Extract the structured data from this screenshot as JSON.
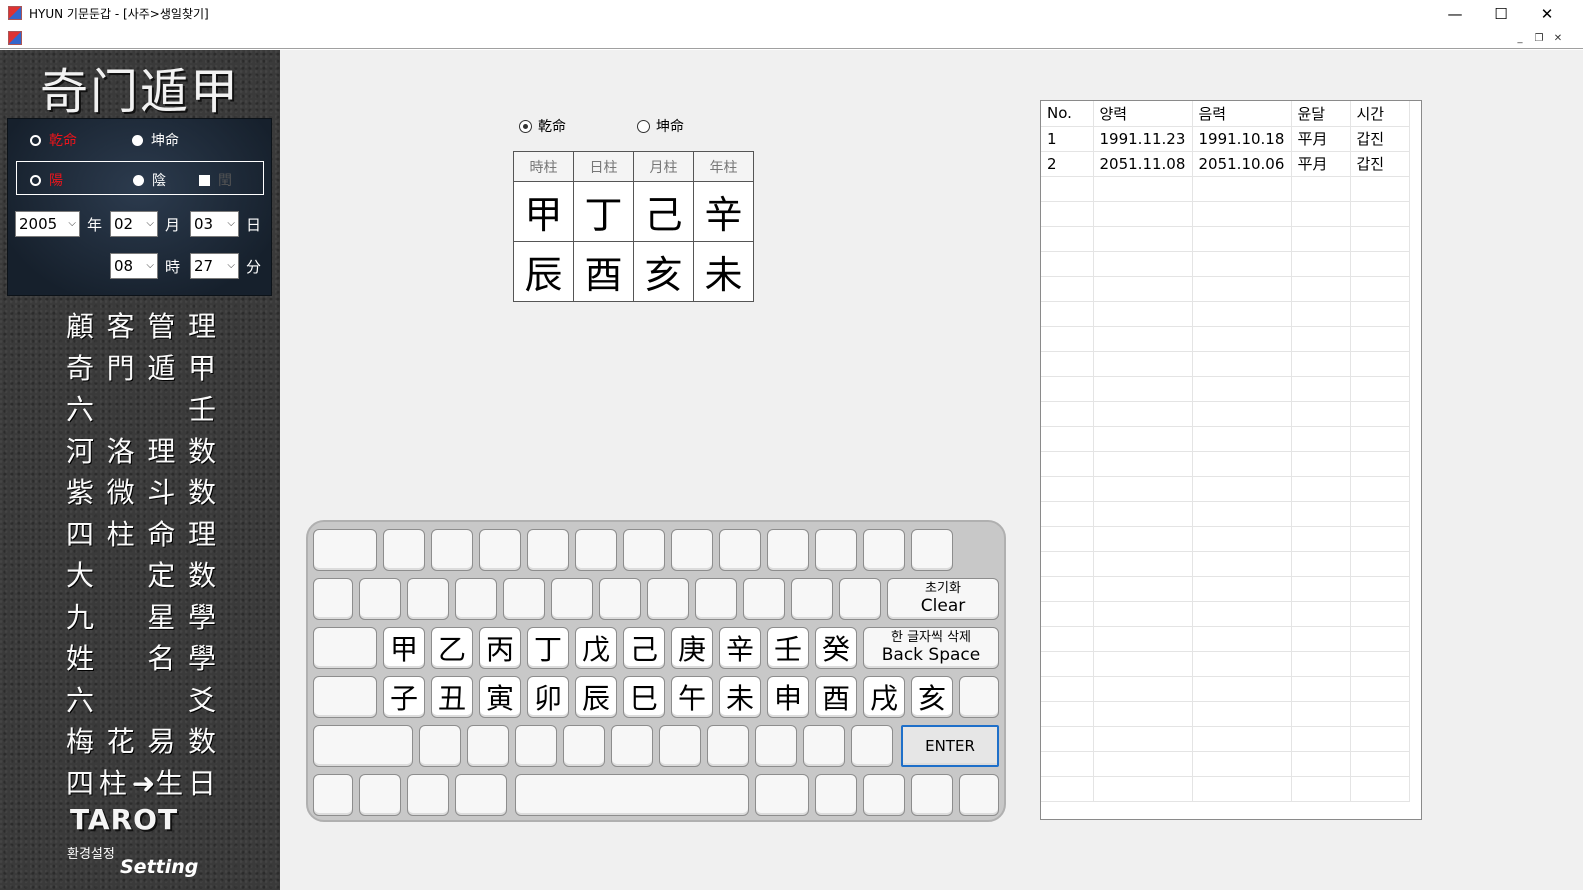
{
  "window": {
    "title": "HYUN 기문둔갑 - [사주>생일찾기]",
    "minimize": "—",
    "maximize": "☐",
    "close": "✕"
  },
  "mdi": {
    "minimize": "_",
    "restore": "❐",
    "close": "✕"
  },
  "sidebar": {
    "logo": "奇门遁甲",
    "gender": {
      "male": "乾命",
      "female": "坤命"
    },
    "yinyang": {
      "yang": "陽",
      "yin": "陰",
      "leap": "閏"
    },
    "date": {
      "year": "2005",
      "year_unit": "年",
      "month": "02",
      "month_unit": "月",
      "day": "03",
      "day_unit": "日",
      "hour": "08",
      "hour_unit": "時",
      "minute": "27",
      "minute_unit": "分"
    },
    "menu": [
      [
        "顧",
        "客",
        "管",
        "理"
      ],
      [
        "奇",
        "門",
        "遁",
        "甲"
      ],
      [
        "六",
        "",
        "",
        "壬"
      ],
      [
        "河",
        "洛",
        "理",
        "数"
      ],
      [
        "紫",
        "微",
        "斗",
        "数"
      ],
      [
        "四",
        "柱",
        "命",
        "理"
      ],
      [
        "大",
        "",
        "定",
        "数"
      ],
      [
        "九",
        "",
        "星",
        "學"
      ],
      [
        "姓",
        "",
        "名",
        "學"
      ],
      [
        "六",
        "",
        "",
        "爻"
      ],
      [
        "梅",
        "花",
        "易",
        "数"
      ],
      [
        "四",
        "柱",
        "➜生",
        "日"
      ]
    ],
    "tarot": "TAROT",
    "setting_kr": "환경설정",
    "setting_en": "Setting"
  },
  "top_radio": {
    "male": "乾命",
    "female": "坤命",
    "selected": "male"
  },
  "pillars": {
    "headers": [
      "時柱",
      "日柱",
      "月柱",
      "年柱"
    ],
    "stems": [
      "甲",
      "丁",
      "己",
      "辛"
    ],
    "branches": [
      "辰",
      "酉",
      "亥",
      "未"
    ]
  },
  "keyboard": {
    "stems": [
      "甲",
      "乙",
      "丙",
      "丁",
      "戊",
      "己",
      "庚",
      "辛",
      "壬",
      "癸"
    ],
    "branches": [
      "子",
      "丑",
      "寅",
      "卯",
      "辰",
      "巳",
      "午",
      "未",
      "申",
      "酉",
      "戌",
      "亥"
    ],
    "clear_kr": "초기화",
    "clear_en": "Clear",
    "backspace_kr": "한 글자씩 삭제",
    "backspace_en": "Back Space",
    "enter": "ENTER"
  },
  "results": {
    "columns": [
      "No.",
      "양력",
      "음력",
      "윤달",
      "시간"
    ],
    "rows": [
      [
        "1",
        "1991.11.23",
        "1991.10.18",
        "平月",
        "갑진"
      ],
      [
        "2",
        "2051.11.08",
        "2051.10.06",
        "平月",
        "갑진"
      ]
    ]
  }
}
